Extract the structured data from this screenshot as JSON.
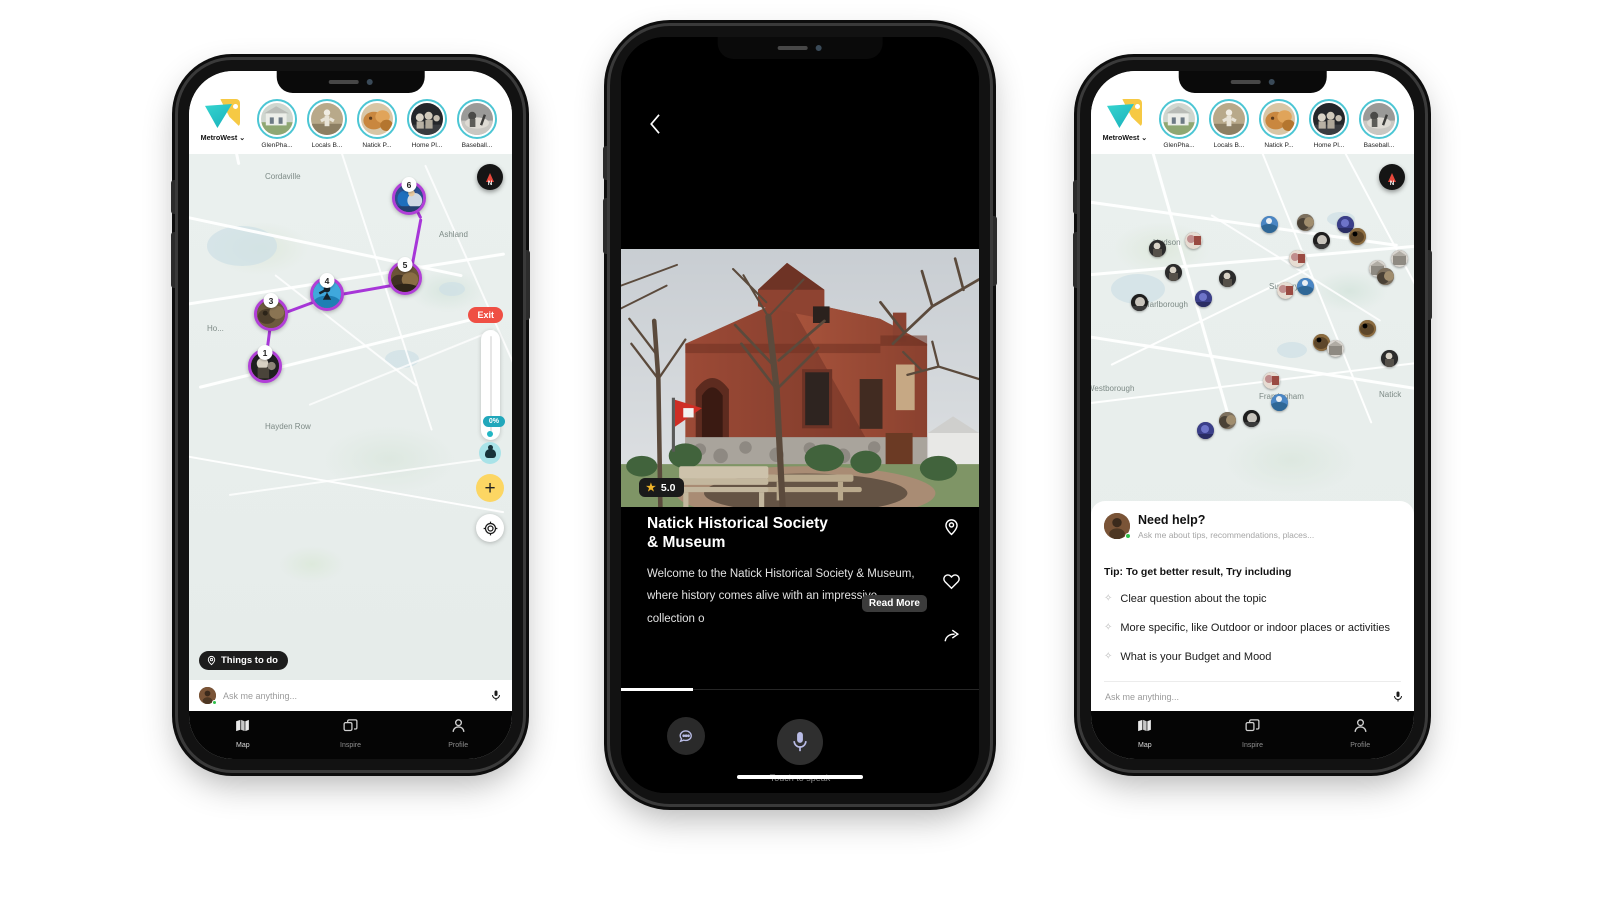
{
  "app": {
    "brand_name": "MetroWest",
    "brand_chevron": "⌄",
    "colors": {
      "brand_teal": "#35d4cf",
      "brand_yellow": "#f6c944",
      "story_ring": "#4cc6d4",
      "route_purple": "#a736d8",
      "exit_red": "#ef4f44",
      "plus_yellow": "#fcd663",
      "progress_teal": "#21a7bb",
      "online_green": "#2ec04a",
      "star_gold": "#f0b429"
    }
  },
  "stories": [
    {
      "label": "GlenPha...",
      "icon": "story-thumb-house"
    },
    {
      "label": "Locals B...",
      "icon": "story-thumb-locals"
    },
    {
      "label": "Natick P...",
      "icon": "story-thumb-natick"
    },
    {
      "label": "Home Pl...",
      "icon": "story-thumb-home"
    },
    {
      "label": "Baseball...",
      "icon": "story-thumb-baseball"
    }
  ],
  "phone1": {
    "map_labels": [
      "Cordaville",
      "Ashland",
      "Ho...",
      "Hayden Row"
    ],
    "route_markers": [
      {
        "number": "1"
      },
      {
        "number": "3"
      },
      {
        "number": "4"
      },
      {
        "number": "5"
      },
      {
        "number": "6"
      }
    ],
    "controls": {
      "exit_label": "Exit",
      "progress_label": "0%",
      "plus_label": "+",
      "compass_label": "N",
      "things_to_do_label": "Things to do",
      "locate_icon": "locate-icon",
      "avatar_icon": "walker-icon"
    },
    "ask": {
      "placeholder": "Ask me anything...",
      "mic_icon": "microphone-icon",
      "avatar_icon": "user-avatar"
    },
    "tabs": [
      {
        "label": "Map",
        "icon": "map-icon",
        "active": true
      },
      {
        "label": "Inspire",
        "icon": "layers-icon",
        "active": false
      },
      {
        "label": "Profile",
        "icon": "person-icon",
        "active": false
      }
    ]
  },
  "phone2": {
    "back_icon": "chevron-left-icon",
    "rating": "5.0",
    "star_icon": "star-icon",
    "title_line1": "Natick Historical Society",
    "title_line2": "& Museum",
    "description": "Welcome to the Natick Historical Society & Museum, where history comes alive with an impressive collection o",
    "read_more_label": "Read More",
    "actions": [
      {
        "icon": "location-pin-icon"
      },
      {
        "icon": "heart-icon"
      },
      {
        "icon": "share-icon"
      }
    ],
    "chat_icon": "chat-bubble-icon",
    "mic_icon": "microphone-icon",
    "mic_label": "Touch to speak"
  },
  "phone3": {
    "map_labels": [
      "Hudson",
      "Sudbury",
      "Marlborough",
      "Westborough",
      "Framingham",
      "Natick"
    ],
    "help": {
      "title": "Need help?",
      "subtitle": "Ask me about tips, recommendations, places...",
      "tip_title": "Tip: To get better result, Try including",
      "tips": [
        "Clear question about the topic",
        "More specific, like Outdoor or indoor places or activities",
        "What is your Budget and Mood"
      ],
      "sparkle_icon": "sparkle-icon"
    },
    "ask": {
      "placeholder": "Ask me anything...",
      "mic_icon": "microphone-icon"
    },
    "tabs": [
      {
        "label": "Map",
        "icon": "map-icon",
        "active": true
      },
      {
        "label": "Inspire",
        "icon": "layers-icon",
        "active": false
      },
      {
        "label": "Profile",
        "icon": "person-icon",
        "active": false
      }
    ]
  }
}
